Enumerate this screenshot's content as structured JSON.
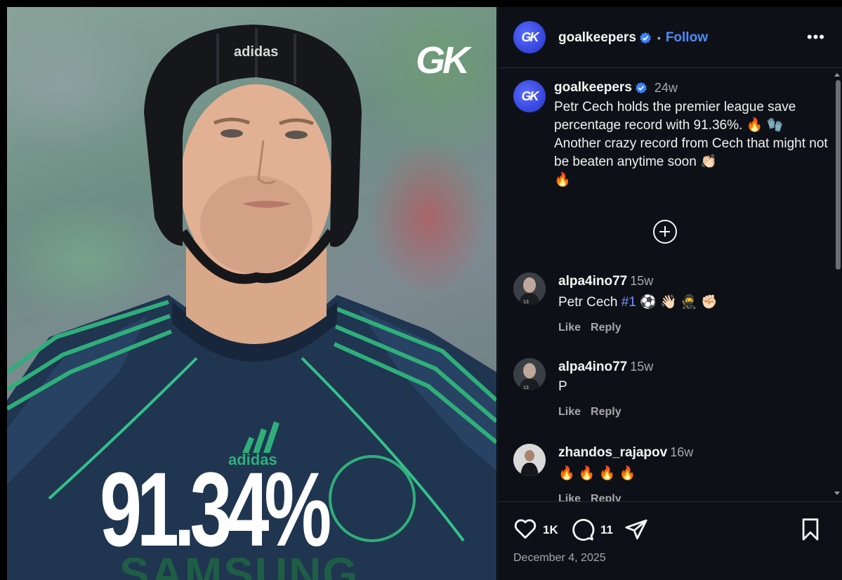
{
  "media": {
    "watermark": "GK",
    "headline_stat": "91.34%",
    "kit_brand": "adidas",
    "sponsor": "SAMSUNG"
  },
  "header": {
    "avatar_text": "GK",
    "username": "goalkeepers",
    "separator": "•",
    "follow_label": "Follow",
    "more_label": "•••"
  },
  "caption": {
    "avatar_text": "GK",
    "username": "goalkeepers",
    "time": "24w",
    "line1": "Petr Cech holds the premier league save percentage record with 91.36%.",
    "line1_emojis": "🔥 🧤",
    "line2": "Another crazy record from Cech that might not be beaten anytime soon",
    "line2_emojis": "👏🏻",
    "line3_emojis": "🔥"
  },
  "comments": [
    {
      "username": "alpa4ino77",
      "time": "15w",
      "text_before": "Petr Cech",
      "hashtag": "#1",
      "text_after": "⚽ 👋🏻 🥷 ✊🏻",
      "like_label": "Like",
      "reply_label": "Reply"
    },
    {
      "username": "alpa4ino77",
      "time": "15w",
      "text_before": "P",
      "hashtag": "",
      "text_after": "",
      "like_label": "Like",
      "reply_label": "Reply"
    },
    {
      "username": "zhandos_rajapov",
      "time": "16w",
      "text_before": "🔥 🔥 🔥 🔥",
      "hashtag": "",
      "text_after": "",
      "like_label": "Like",
      "reply_label": "Reply"
    }
  ],
  "footer": {
    "likes": "1K",
    "comments": "11",
    "date": "December 4, 2025"
  },
  "colors": {
    "panel_bg": "#0d1117",
    "accent_blue": "#4d8cff",
    "hashtag": "#7b93ff",
    "muted": "#a8a8a8"
  },
  "icons": [
    "verified-badge-icon",
    "heart-icon",
    "comment-icon",
    "share-icon",
    "bookmark-icon",
    "add-comment-icon",
    "more-icon"
  ]
}
